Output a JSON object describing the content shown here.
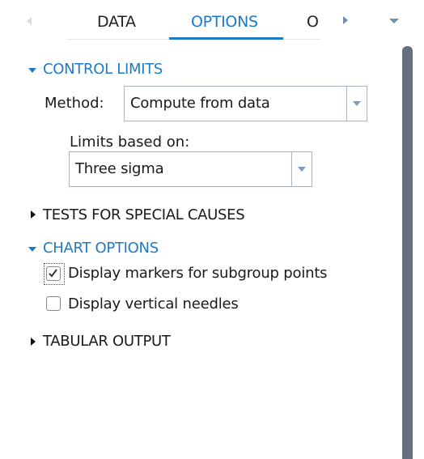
{
  "tabs": [
    {
      "label": "DATA",
      "active": false
    },
    {
      "label": "OPTIONS",
      "active": true
    },
    {
      "label": "O",
      "active": false
    }
  ],
  "accent": "#1f7ac6",
  "sections": {
    "control_limits": {
      "title": "CONTROL LIMITS",
      "expanded": true,
      "method_label": "Method:",
      "method_value": "Compute from data",
      "limits_label": "Limits based on:",
      "limits_value": "Three sigma"
    },
    "tests": {
      "title": "TESTS FOR SPECIAL CAUSES",
      "expanded": false
    },
    "chart_options": {
      "title": "CHART OPTIONS",
      "expanded": true,
      "checkboxes": [
        {
          "label": "Display markers for subgroup points",
          "checked": true
        },
        {
          "label": "Display vertical needles",
          "checked": false
        }
      ]
    },
    "tabular": {
      "title": "TABULAR OUTPUT",
      "expanded": false
    }
  }
}
